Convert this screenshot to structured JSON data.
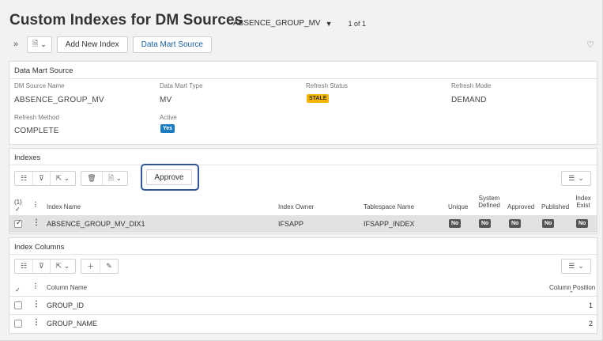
{
  "header": {
    "title": "Custom Indexes for DM Sources",
    "context_value": "ABSENCE_GROUP_MV",
    "record_count": "1 of 1"
  },
  "toolbar": {
    "add_new_index_label": "Add New Index",
    "data_mart_source_label": "Data Mart Source"
  },
  "data_mart_source": {
    "title": "Data Mart Source",
    "fields": {
      "dm_source_name_label": "DM Source Name",
      "dm_source_name_value": "ABSENCE_GROUP_MV",
      "data_mart_type_label": "Data Mart Type",
      "data_mart_type_value": "MV",
      "refresh_status_label": "Refresh Status",
      "refresh_status_value": "STALE",
      "refresh_mode_label": "Refresh Mode",
      "refresh_mode_value": "DEMAND",
      "refresh_method_label": "Refresh Method",
      "refresh_method_value": "COMPLETE",
      "active_label": "Active",
      "active_value": "Yes"
    }
  },
  "indexes": {
    "title": "Indexes",
    "approve_label": "Approve",
    "selection_count": "(1)",
    "columns": {
      "index_name": "Index Name",
      "index_owner": "Index Owner",
      "tablespace_name": "Tablespace Name",
      "unique": "Unique",
      "system_defined_1": "System",
      "system_defined_2": "Defined",
      "approved": "Approved",
      "published": "Published",
      "index_exist_1": "Index",
      "index_exist_2": "Exist"
    },
    "rows": [
      {
        "index_name": "ABSENCE_GROUP_MV_DIX1",
        "index_owner": "IFSAPP",
        "tablespace_name": "IFSAPP_INDEX",
        "unique": "No",
        "system_defined": "No",
        "approved": "No",
        "published": "No",
        "index_exist": "No"
      }
    ]
  },
  "index_columns": {
    "title": "Index Columns",
    "columns": {
      "column_name": "Column Name",
      "column_position": "Column Position"
    },
    "rows": [
      {
        "column_name": "GROUP_ID",
        "column_position": "1"
      },
      {
        "column_name": "GROUP_NAME",
        "column_position": "2"
      }
    ]
  }
}
